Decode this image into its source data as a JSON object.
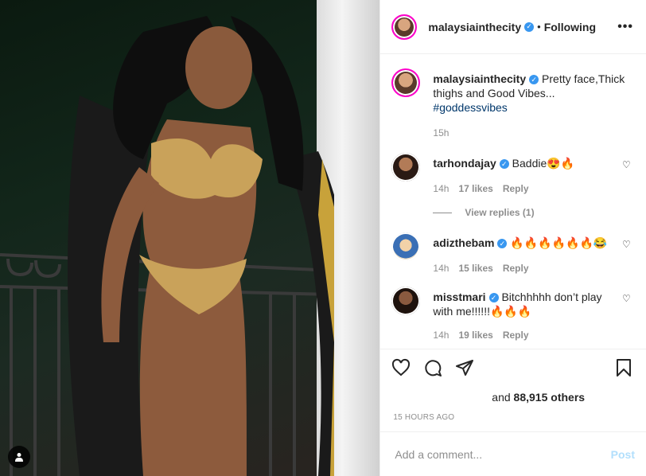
{
  "header": {
    "username": "malaysiainthecity",
    "separator": "•",
    "follow_status": "Following",
    "more": "•••"
  },
  "caption": {
    "username": "malaysiainthecity",
    "text": "Pretty face,Thick thighs and Good Vibes...",
    "hashtag": "#goddessvibes",
    "time": "15h"
  },
  "comments": [
    {
      "username": "tarhondajay",
      "text": "Baddie😍🔥",
      "time": "14h",
      "likes": "17 likes",
      "reply": "Reply"
    },
    {
      "username": "adizthebam",
      "text": "🔥🔥🔥🔥🔥🔥😂",
      "time": "14h",
      "likes": "15 likes",
      "reply": "Reply"
    },
    {
      "username": "misstmari",
      "text": "Bitchhhhh don’t play with me!!!!!!🔥🔥🔥",
      "time": "14h",
      "likes": "19 likes",
      "reply": "Reply"
    }
  ],
  "view_replies": "View replies (1)",
  "likes": {
    "prefix": "and",
    "count": "88,915",
    "suffix": "others"
  },
  "timestamp": "15 HOURS AGO",
  "comment_box": {
    "placeholder": "Add a comment...",
    "post_label": "Post"
  },
  "colors": {
    "verified": "#3897f0",
    "post_disabled": "#b2dffc",
    "hashtag": "#00376b"
  },
  "icons": [
    "heart-icon",
    "comment-icon",
    "share-icon",
    "bookmark-icon",
    "user-tag-icon",
    "verified-icon"
  ]
}
